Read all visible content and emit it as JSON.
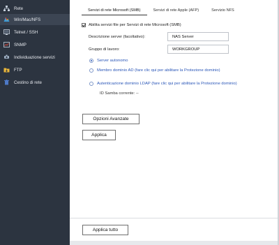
{
  "sidebar": {
    "items": [
      {
        "label": "Rete",
        "icon": "network-icon"
      },
      {
        "label": "Win/Mac/NFS",
        "icon": "shared-folder-icon"
      },
      {
        "label": "Telnet / SSH",
        "icon": "terminal-icon"
      },
      {
        "label": "SNMP",
        "icon": "snmp-icon"
      },
      {
        "label": "Individuazione servizi",
        "icon": "service-discovery-icon"
      },
      {
        "label": "FTP",
        "icon": "ftp-icon"
      },
      {
        "label": "Cestino di rete",
        "icon": "recycle-bin-icon"
      }
    ],
    "active_index": 1,
    "background": "#2c3440"
  },
  "tabs": [
    {
      "label": "Servizi di rete Microsoft (SMB)"
    },
    {
      "label": "Servizi di rete Apple (AFP)"
    },
    {
      "label": "Servizio NFS"
    }
  ],
  "form": {
    "enable_label": "Abilita servizi file per Servizi di rete Microsoft (SMB)",
    "enable_checked": true,
    "description_label": "Descrizione server (facoltativo):",
    "description_value": "NAS Server",
    "workgroup_label": "Gruppo di lavoro:",
    "workgroup_value": "WORKGROUP",
    "radio_standalone": "Server autonomo",
    "radio_ad": "Membro dominio AD (fare clic qui per abilitare la Protezione dominio)",
    "radio_ldap": "Autenticazione dominio LDAP (fare clic qui per abilitare la Protezione dominio)",
    "samba_id": "ID Samba corrente: --"
  },
  "buttons": {
    "advanced": "Opzioni Avanzate",
    "apply": "Applica",
    "apply_all": "Applica tutto"
  },
  "colors": {
    "link_blue": "#2b57b8",
    "sidebar_active": "#3c4553"
  }
}
